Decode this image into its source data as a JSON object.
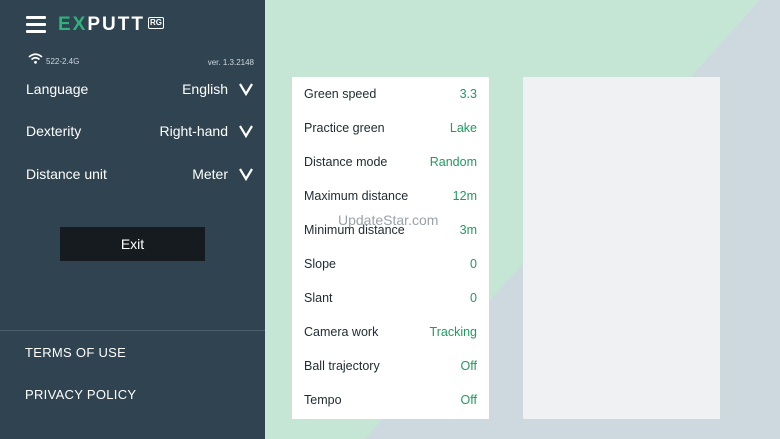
{
  "app": {
    "logo_ex": "EX",
    "logo_putt": "PUTT",
    "logo_badge": "RG",
    "wifi_name": "522-2.4G",
    "version": "ver. 1.3.2148"
  },
  "colors": {
    "sidebar_bg": "#2f4350",
    "accent_green": "#1e9c5d",
    "bg_mint": "#c6e6d5",
    "bg_gray": "#cdd8df"
  },
  "settings": [
    {
      "label": "Language",
      "value": "English"
    },
    {
      "label": "Dexterity",
      "value": "Right-hand"
    },
    {
      "label": "Distance unit",
      "value": "Meter"
    }
  ],
  "exit_label": "Exit",
  "footer": {
    "terms": "TERMS OF USE",
    "privacy": "PRIVACY POLICY"
  },
  "info": [
    {
      "label": "Green speed",
      "value": "3.3"
    },
    {
      "label": "Practice green",
      "value": "Lake"
    },
    {
      "label": "Distance mode",
      "value": "Random"
    },
    {
      "label": "Maximum distance",
      "value": "12m"
    },
    {
      "label": "Minimum distance",
      "value": "3m"
    },
    {
      "label": "Slope",
      "value": "0"
    },
    {
      "label": "Slant",
      "value": "0"
    },
    {
      "label": "Camera work",
      "value": "Tracking"
    },
    {
      "label": "Ball trajectory",
      "value": "Off"
    },
    {
      "label": "Tempo",
      "value": "Off"
    }
  ],
  "watermark": "UpdateStar.com"
}
